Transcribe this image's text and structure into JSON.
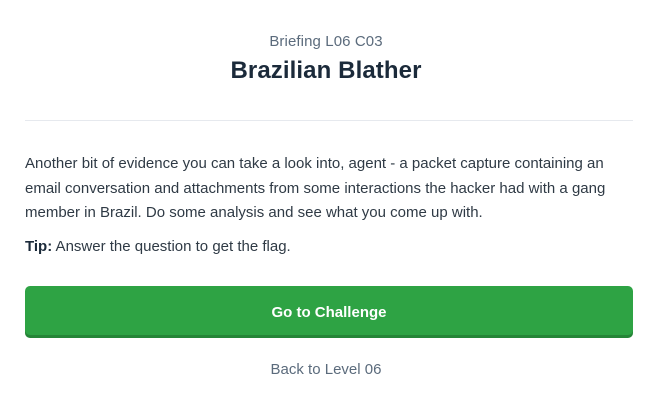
{
  "header": {
    "subtitle": "Briefing L06 C03",
    "title": "Brazilian Blather"
  },
  "body": {
    "description": "Another bit of evidence you can take a look into, agent - a packet capture containing an email conversation and attachments from some interactions the hacker had with a gang member in Brazil. Do some analysis and see what you come up with.",
    "tip_label": "Tip:",
    "tip_text": " Answer the question to get the flag."
  },
  "actions": {
    "primary_label": "Go to Challenge",
    "back_label": "Back to Level 06"
  },
  "colors": {
    "primary_button": "#2ea344",
    "title_text": "#1b2a3a",
    "muted_text": "#5b6b7c"
  }
}
